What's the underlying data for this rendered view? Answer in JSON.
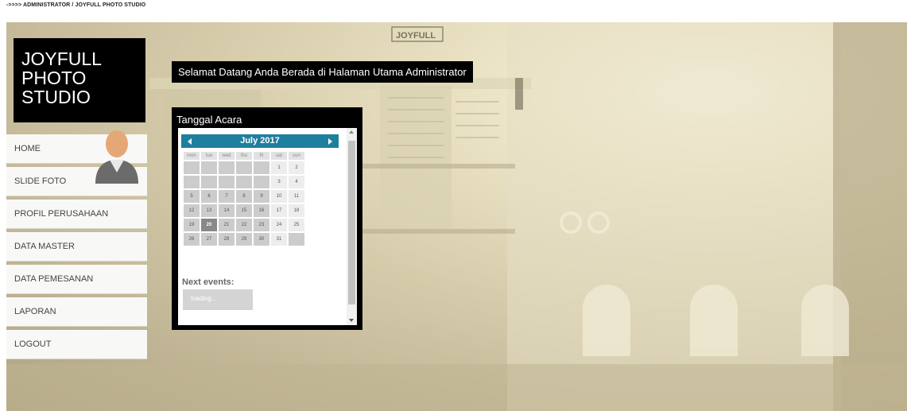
{
  "breadcrumb": "->>>> ADMINISTRATOR / JOYFULL PHOTO STUDIO",
  "logo": {
    "line1": "JOYFULL",
    "line2": "PHOTO",
    "line3": "STUDIO"
  },
  "sign_text": "JOYFULL",
  "welcome_text": "Selamat Datang Anda Berada di Halaman Utama Administrator",
  "menu": [
    {
      "label": "HOME"
    },
    {
      "label": "SLIDE FOTO"
    },
    {
      "label": "PROFIL PERUSAHAAN"
    },
    {
      "label": "DATA MASTER"
    },
    {
      "label": "DATA PEMESANAN"
    },
    {
      "label": "LAPORAN"
    },
    {
      "label": "LOGOUT"
    }
  ],
  "calendar": {
    "title": "Tanggal Acara",
    "month": "July 2017",
    "day_names": [
      "mon",
      "tue",
      "wed",
      "thu",
      "fri",
      "sat",
      "sun"
    ],
    "weeks": [
      [
        "",
        "",
        "",
        "",
        "",
        "1",
        "2"
      ],
      [
        "",
        "",
        "",
        "",
        "",
        "3",
        "4"
      ],
      [
        "5",
        "6",
        "7",
        "8",
        "9",
        "10",
        "11"
      ],
      [
        "12",
        "13",
        "14",
        "15",
        "16",
        "17",
        "18"
      ],
      [
        "19",
        "20",
        "21",
        "22",
        "23",
        "24",
        "25"
      ],
      [
        "26",
        "27",
        "28",
        "29",
        "30",
        "31",
        ""
      ]
    ],
    "today": "20",
    "next_events_label": "Next events:",
    "loading_label": "loading..."
  },
  "colors": {
    "calendar_header": "#1f7f9f",
    "panel": "#000000"
  },
  "icons": {
    "avatar": "user-avatar-icon",
    "prev": "arrow-left-icon",
    "next": "arrow-right-icon"
  }
}
